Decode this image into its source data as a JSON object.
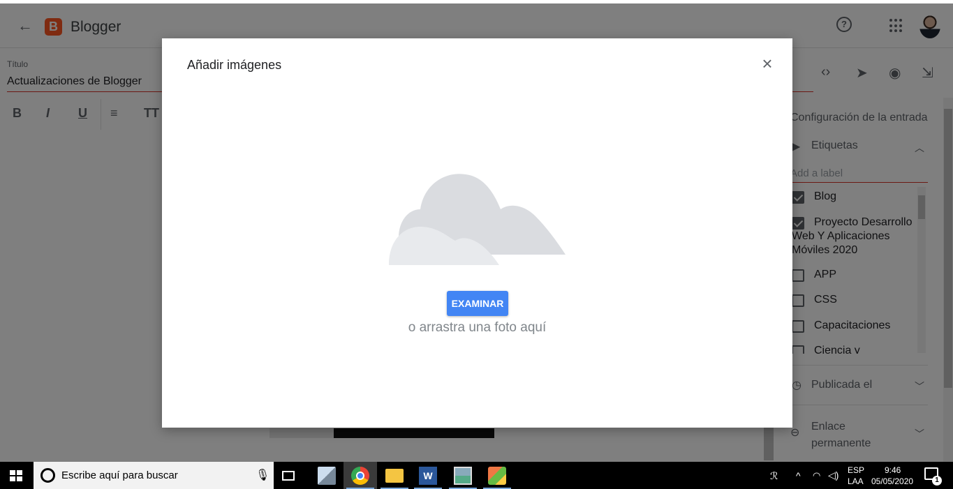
{
  "header": {
    "back_icon": "arrow-left-icon",
    "app_name": "Blogger",
    "logo_letter": "B",
    "help_icon_glyph": "?",
    "brand_color": "#ff5722"
  },
  "editor": {
    "title_label": "Título",
    "title_value": "Actualizaciones de Blogger",
    "format_buttons": [
      "B",
      "I",
      "U",
      "≡",
      "TT"
    ]
  },
  "right_toolbar": {
    "icons": [
      "code-icon",
      "send-icon",
      "preview-icon",
      "add-to-drive-icon"
    ],
    "glyphs": [
      "‹›",
      "➤",
      "◉",
      "⇲"
    ]
  },
  "panel": {
    "title": "Configuración de la entrada",
    "labels_section": "Etiquetas",
    "label_placeholder": "Add a label",
    "labels": [
      {
        "text": "Blog",
        "checked": true
      },
      {
        "text": "Proyecto Desarrollo Web Y Aplicaciones Móviles 2020",
        "checked": true
      },
      {
        "text": "APP",
        "checked": false
      },
      {
        "text": "CSS",
        "checked": false
      },
      {
        "text": "Capacitaciones",
        "checked": false
      },
      {
        "text": "Ciencia y",
        "checked": false
      }
    ],
    "published_section": "Publicada el",
    "permalink_section": "Enlace permanente"
  },
  "modal": {
    "title": "Añadir imágenes",
    "close_glyph": "×",
    "browse_button": "EXAMINAR",
    "drop_text": "o arrastra una foto aquí",
    "button_color": "#4285f4"
  },
  "taskbar": {
    "search_placeholder": "Escribe aquí para buscar",
    "word_letter": "W",
    "language": "ESP",
    "layout": "LAA",
    "time": "9:46",
    "date": "05/05/2020",
    "notification_count": "1"
  }
}
